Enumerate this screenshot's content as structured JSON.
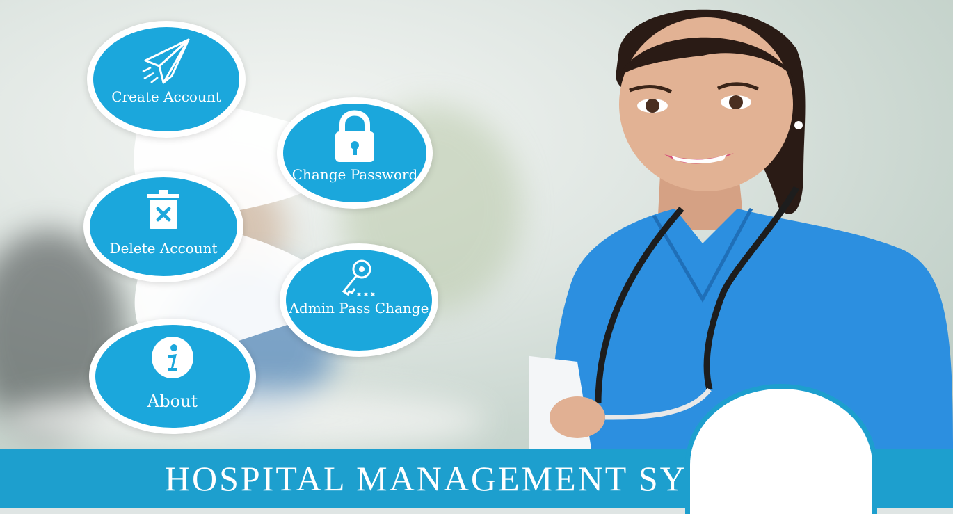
{
  "menu": {
    "create_account": "Create Account",
    "change_password": "Change Password",
    "delete_account": "Delete Account",
    "admin_pass_change": "Admin Pass Change",
    "about": "About"
  },
  "footer": {
    "title": "HOSPITAL MANAGEMENT SYSTEM"
  },
  "icons": {
    "create_account": "paper-plane-icon",
    "change_password": "lock-icon",
    "delete_account": "trash-icon",
    "admin_pass_change": "key-icon",
    "about": "info-icon"
  },
  "colors": {
    "accent": "#1ba7dc",
    "footer": "#1d9fce",
    "scrubs": "#2c8fe0"
  }
}
